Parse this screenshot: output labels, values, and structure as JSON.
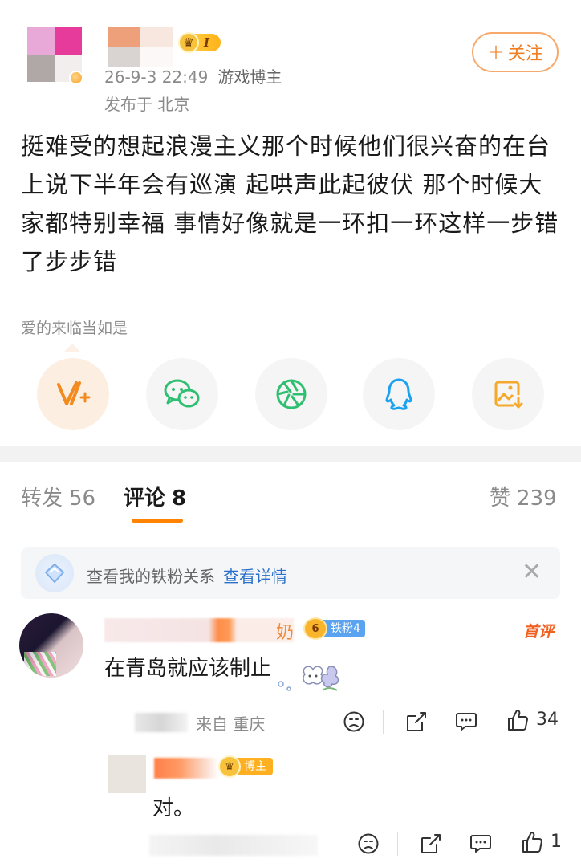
{
  "post": {
    "time": "26-9-3 22:49",
    "user_tag": "游戏博主",
    "location": "发布于 北京",
    "vip_level": "I",
    "follow_label": "关注",
    "text": "挺难受的想起浪漫主义那个时候他们很兴奋的在台上说下半年会有巡演 起哄声此起彼伏 那个时候大家都特别幸福 事情好像就是一环扣一环这样一步错了步步错",
    "topic": "爱的来临当如是"
  },
  "share": [
    {
      "icon": "vplus-icon",
      "color": "#f28a1e"
    },
    {
      "icon": "wechat-icon",
      "color": "#2fbf71"
    },
    {
      "icon": "moments-icon",
      "color": "#2fbf71"
    },
    {
      "icon": "qq-icon",
      "color": "#1aa1f0"
    },
    {
      "icon": "save-image-icon",
      "color": "#f4a92a"
    }
  ],
  "tabs": {
    "repost_label": "转发",
    "repost_count": "56",
    "comment_label": "评论",
    "comment_count": "8",
    "like_label": "赞",
    "like_count": "239"
  },
  "fan_banner": {
    "text": "查看我的铁粉关系",
    "link": "查看详情"
  },
  "comments": [
    {
      "name_tail": "奶",
      "fan_level": "铁粉4",
      "crown_num": "6",
      "first_label": "首评",
      "text": "在青岛就应该制止",
      "time_suffix": "来自 重庆",
      "like_count": "34"
    }
  ],
  "reply": {
    "role_badge": "博主",
    "text": "对。",
    "like_count": "1"
  },
  "colors": {
    "accent": "#ff8200",
    "link": "#2a6fc9"
  }
}
